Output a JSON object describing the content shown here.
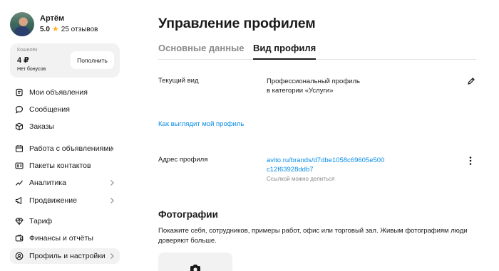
{
  "user": {
    "name": "Артём",
    "rating": "5.0",
    "reviews": "25 отзывов"
  },
  "wallet": {
    "label": "Кошелёк",
    "amount": "4 ₽",
    "bonus": "Нет бонусов",
    "topup_label": "Пополнить"
  },
  "nav": {
    "items": [
      {
        "label": "Мои объявления",
        "icon": "listings-icon"
      },
      {
        "label": "Сообщения",
        "icon": "chat-icon"
      },
      {
        "label": "Заказы",
        "icon": "box-icon"
      },
      {
        "label": "Работа с объявлениями",
        "icon": "calendar-icon"
      },
      {
        "label": "Пакеты контактов",
        "icon": "contacts-card-icon"
      },
      {
        "label": "Аналитика",
        "icon": "chart-icon"
      },
      {
        "label": "Продвижение",
        "icon": "megaphone-icon"
      },
      {
        "label": "Тариф",
        "icon": "diamond-icon"
      },
      {
        "label": "Финансы и отчёты",
        "icon": "wallet-icon"
      },
      {
        "label": "Профиль и настройки",
        "icon": "user-icon"
      }
    ]
  },
  "main": {
    "title": "Управление профилем",
    "tabs": [
      "Основные данные",
      "Вид профиля"
    ],
    "current_view": {
      "label": "Текущий вид",
      "value_line1": "Профессиональный профиль",
      "value_line2": "в категории «Услуги»"
    },
    "preview_link": "Как выглядит мой профиль",
    "address": {
      "label": "Адрес профиля",
      "url_line1": "avito.ru/brands/d7dbe1058c69605e500",
      "url_line2": "c12f63928ddb7",
      "hint": "Ссылкой можно делиться"
    },
    "photos": {
      "title": "Фотографии",
      "description": "Покажите себя, сотрудников, примеры работ, офис или торговый зал. Живым фотографиям люди доверяют больше."
    }
  },
  "colors": {
    "link": "#0a8ee6",
    "star": "#ffb021",
    "panel": "#f2f2f2"
  }
}
